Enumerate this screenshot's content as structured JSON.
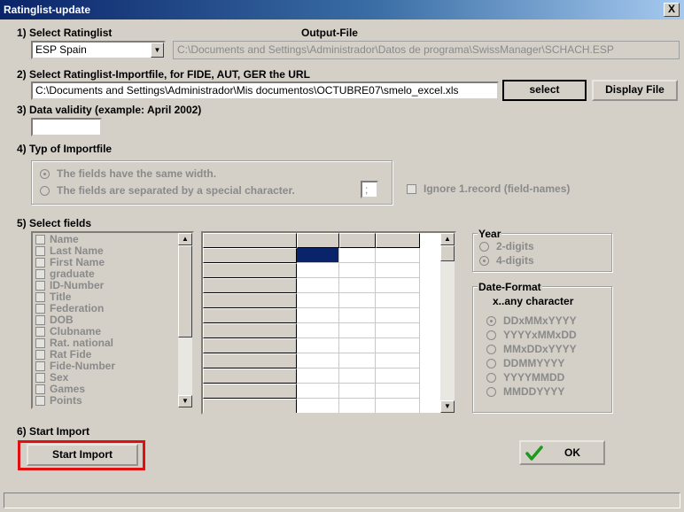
{
  "window": {
    "title": "Ratinglist-update",
    "close_glyph": "X"
  },
  "step1": {
    "label": "1) Select Ratinglist",
    "selected": "ESP  Spain",
    "output_label": "Output-File",
    "output_value": "C:\\Documents and Settings\\Administrador\\Datos de programa\\SwissManager\\SCHACH.ESP"
  },
  "step2": {
    "label": "2) Select Ratinglist-Importfile, for FIDE, AUT, GER the URL",
    "value": "C:\\Documents and Settings\\Administrador\\Mis documentos\\OCTUBRE07\\smelo_excel.xls",
    "select_label": "select",
    "display_label": "Display File"
  },
  "step3": {
    "label": "3) Data validity (example: April 2002)",
    "value": ""
  },
  "step4": {
    "label": "4) Typ of Importfile",
    "option1": "The fields have the same width.",
    "option2": "The fields are separated by a special character.",
    "separator": ";",
    "ignore_label": "Ignore 1.record (field-names)"
  },
  "step5": {
    "label": "5) Select fields",
    "fields": [
      "Name",
      "Last Name",
      "First Name",
      "graduate",
      "ID-Number",
      "Title",
      "Federation",
      "DOB",
      "Clubname",
      "Rat. national",
      "Rat Fide",
      "Fide-Number",
      "Sex",
      "Games",
      "Points"
    ]
  },
  "year": {
    "label": "Year",
    "options": [
      "2-digits",
      "4-digits"
    ],
    "selected": "4-digits"
  },
  "date_format": {
    "label": "Date-Format",
    "hint": "x..any character",
    "options": [
      "DDxMMxYYYY",
      "YYYYxMMxDD",
      "MMxDDxYYYY",
      "DDMMYYYY",
      "YYYYMMDD",
      "MMDDYYYY"
    ],
    "selected": "DDxMMxYYYY"
  },
  "step6": {
    "label": "6) Start Import",
    "button_label": "Start Import"
  },
  "ok": {
    "label": "OK",
    "icon": "checkmark-icon"
  },
  "colors": {
    "highlight_border": "#e01010",
    "selected_cell": "#0a246a",
    "check_green": "#1c9a1c"
  }
}
